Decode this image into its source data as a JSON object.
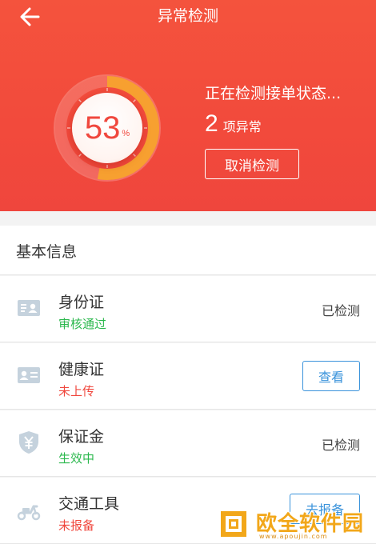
{
  "header": {
    "title": "异常检测",
    "progress_percent": 53,
    "percent_value": "53",
    "percent_unit": "%",
    "status_text": "正在检测接单状态...",
    "abnormal_count": "2",
    "abnormal_label": "项异常",
    "cancel_label": "取消检测"
  },
  "section": {
    "title": "基本信息"
  },
  "items": [
    {
      "name": "身份证",
      "status": "审核通过",
      "status_color": "#2bb84d",
      "action": "已检测",
      "icon": "id-card-icon"
    },
    {
      "name": "健康证",
      "status": "未上传",
      "status_color": "#f0483e",
      "action": "查看",
      "icon": "health-card-icon"
    },
    {
      "name": "保证金",
      "status": "生效中",
      "status_color": "#2bb84d",
      "action": "已检测",
      "icon": "deposit-shield-icon"
    },
    {
      "name": "交通工具",
      "status": "未报备",
      "status_color": "#f0483e",
      "action": "去报备",
      "icon": "scooter-icon"
    }
  ],
  "watermark": {
    "text": "欧全软件园",
    "sub": "www.apoujin.com"
  },
  "colors": {
    "header_red": "#f24a3c",
    "progress_orange": "#f7a030",
    "ok_green": "#2bb84d",
    "warn_red": "#f0483e",
    "link_blue": "#3a93db"
  }
}
